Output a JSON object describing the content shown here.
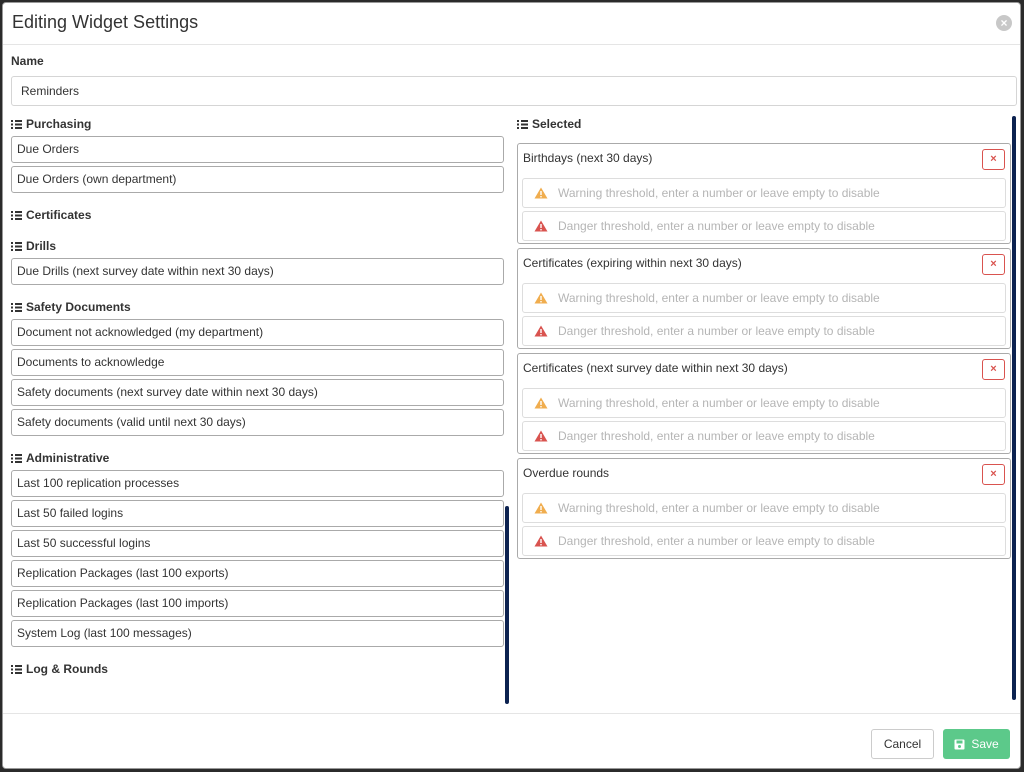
{
  "modal": {
    "title": "Editing Widget Settings",
    "close_icon": "close-circle-icon"
  },
  "name": {
    "label": "Name",
    "value": "Reminders"
  },
  "available": {
    "groups": [
      {
        "title": "Purchasing",
        "items": [
          "Due Orders",
          "Due Orders (own department)"
        ]
      },
      {
        "title": "Certificates",
        "items": []
      },
      {
        "title": "Drills",
        "items": [
          "Due Drills (next survey date within next 30 days)"
        ]
      },
      {
        "title": "Safety Documents",
        "items": [
          "Document not acknowledged (my department)",
          "Documents to acknowledge",
          "Safety documents (next survey date within next 30 days)",
          "Safety documents (valid until next 30 days)"
        ]
      },
      {
        "title": "Administrative",
        "items": [
          "Last 100 replication processes",
          "Last 50 failed logins",
          "Last 50 successful logins",
          "Replication Packages (last 100 exports)",
          "Replication Packages (last 100 imports)",
          "System Log (last 100 messages)"
        ]
      },
      {
        "title": "Log & Rounds",
        "items": []
      }
    ]
  },
  "selected": {
    "title": "Selected",
    "remove_label": "×",
    "warning_placeholder": "Warning threshold, enter a number or leave empty to disable",
    "danger_placeholder": "Danger threshold, enter a number or leave empty to disable",
    "warning_color": "#f0ad4e",
    "danger_color": "#d9534f",
    "items": [
      {
        "title": "Birthdays (next 30 days)"
      },
      {
        "title": "Certificates (expiring within next 30 days)"
      },
      {
        "title": "Certificates (next survey date within next 30 days)"
      },
      {
        "title": "Overdue rounds"
      }
    ]
  },
  "footer": {
    "cancel_label": "Cancel",
    "save_label": "Save",
    "save_color": "#5cc98a"
  }
}
